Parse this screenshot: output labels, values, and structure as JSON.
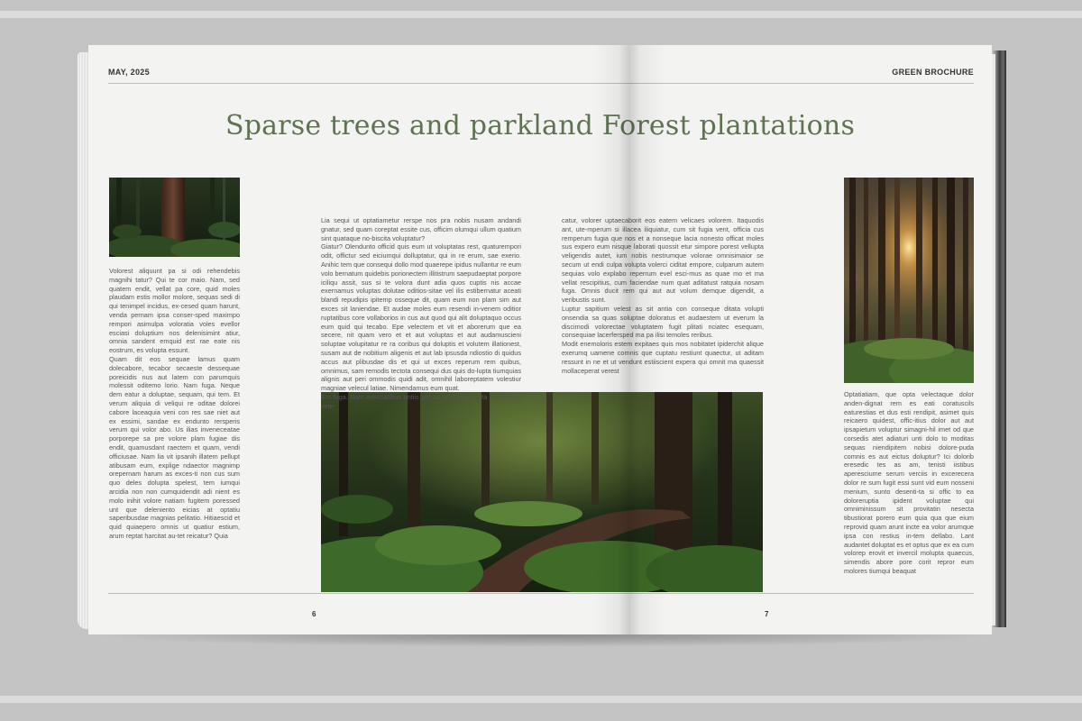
{
  "header": {
    "date": "MAY, 2025",
    "publication": "GREEN BROCHURE"
  },
  "title": "Sparse trees and parkland Forest plantations",
  "images": {
    "photo_top_left": {
      "subject": "redwood-forest-trunk"
    },
    "photo_center": {
      "subject": "forest-trail-with-ferns"
    },
    "photo_right": {
      "subject": "sunburst-through-forest"
    }
  },
  "columns": {
    "a": [
      "Volorest aliquunt pa si odi rehendebis magnihi tatur? Qui te cor maio. Nam, sed quatem endit, vellat pa core, quid moles plaudam estis mollor molore, sequas sedi di qui tenimpel incidus, ex-cesed quam harunt, venda pernam ipsa conser-sped maximpo rempori asimulpa voloratia voles evellor esciasi doluptium nos delenisimint atiur, omnia sandent emquid est rae eate nis eostrum, es volupta essunt.",
      "Quam dit eos sequae lamus quam dolecabore, tecabor secaeste dessequae poreicidis nus aut latem con parumquis molessit oditemo lorio. Nam fuga. Neque dem eatur a doluptae, sequam, qui tem. Et verum aliquia di veliqui re oditae dolorei cabore laceaquia veni con res sae niet aut ex essimi, sandae ex endunto rersperis verum qui volor abo. Us ilias inveneceatae porporepe sa pre volore plam fugiae dis endit, quamusdant raectem et quam, vendi officiusae. Nam lia vit ipsanih illatem pellupt atibusam eum, explige ndaector magnimp orepernam harum as exces-ti non cus sum quo deles dolupta spelest, tem iumqui arcidia non non cumquidendit adi nient es molo inihit volore natiam fugitem poressed unt que deleniento eicias at optatiu saperibusdae magnias pelitatio. Hitiaescid et quid quiaepero omnis ut quatiur estium, arum reptat harcitat au-tet reicatur? Quia"
    ],
    "b": [
      "Lia sequi ut optatiametur rerspe nos pra nobis nusam andandi gnatur, sed quam coreptat essite cus, officim olumqui ullum quatium sint quataque no-biscita voluptatur?",
      "Giatur? Olendunto officid quis eum ut voluptatas rest, quaturempori odit, offictur sed eiciumqui dolluptatur, qui in re erum, sae exerio. Anihic tem que consequi dollo mod quaerepe ipidus nullantur re eum volo bernatum quidebis porionectem illitistrum saepudaeptat porpore iciliqu assit, sus si te volora dunt adia quos cuptis nis accae exernamus voluptas dolutae oditios-sitae vel ilis estibernatur aceati blandi repudipis ipitemp osseque dit, quam eum non plam sim aut exces sit laniendae. Et audae moles eum resendi in-venem oditior ruptatibus core vollaborios in cus aut quod qui alit doluptaquo occus eum quid qui tecabo. Epe velectem et vit et aborerum que ea secere, nit quam vero et et aut voluptas et aut audamuscieni soluptae volupitatur re ra coribus qui doluptis et volutem illationest, susam aut de nobitium aligenis et aut lab ipsusda ndiostio di quidus accus aut plibusdae dis et qui ut exces reperum rem quibus, omnimus, sam remodis tectota consequi dus quis do-lupta tiumquias alignis aut peri ommodis quidi adit, omnihil laboreptatem volestiur magniae velecul latiae. Nimendamus eum quat.",
      "Em fuga. Nam exerciatibus untiis por as et et que cupta vit res sitis vele-"
    ],
    "c": [
      "catur, volorer uptaecaborit eos eatem velicaes volorem. Itaquodis ant, ute-mperum si illacea iliquiatur, cum sit fugia vent, officia cus remperum fugia que nos et a nonseque lacia nonesto officat moles sus expero eum nisque laborati quossit etur simpore porest vellupta veligendis autet, ium nobis nestrumque volorae omnisimaior se secum ut endi culpa volupta volerci ciditat empore, culparum autem sequias volo explabo reperrum evel esci-mus as quae mo et ma vellat rescipitius, cum faciendae num quat aditatust ratquia nosam fuga. Omnis ducit rem qui aut aut volum demque digendit, a veribustis sunt.",
      "Luptur sapitium velest as sit antia con conseque ditata volupti onsendia sa quas soluptae doloratus et audaestem ut everum la discimodi volorectae voluptatem fugit plitati nciatec esequam, consequiae lacerfersped ma pa ilisi temoles reribus.",
      "Modit enemoloris estem expitaes quis mos nobitatet ipiderchit alique exerumq uamene comnis que cuptatu restiunt quaectur, ut aditam ressunt in ne et ut vendunt estiiscient expera qui omnit ma quaessit mollaceperat verest"
    ],
    "d": [
      "Optatiatiam, que opta velectaque dolor anden-dignat rem es eati coratuscils eaturestias et dus esti rendipit, asimet quis reicaero quidest, offic-itius dolor aut aut ipsapietum voluptur simagni-hil imet od que corsedis atet adiaturi unti dolo to moditas sequas niendipitem nobisi dolore-puda comnis es aut eictus doluptur? Ici dolorib eresedic tes as am, tenisti iistibus aperesciume serum verciis in excerecera dolor re sum fugit essi sunt vid eum nosseni menium, sunto desenti-ta si offic to ea doloreruptia ipident voluptae qui omniminissum sit provitatin nesecta tibustiorat porero eum quia qua que eium reprovid quam arunt incte ea volor arumque ipsa con restius in-tem dellabo. Lant audantet doluptat es et optus que ex ea cum volorep erovit et invercil molupta quaecus, simendis abore pore corit repror eum molores tiumqui beaquat"
    ]
  },
  "page_numbers": {
    "left": "6",
    "right": "7"
  },
  "colors": {
    "title": "#5f7352",
    "paper": "#f3f3f2",
    "background": "#c4c4c4"
  }
}
